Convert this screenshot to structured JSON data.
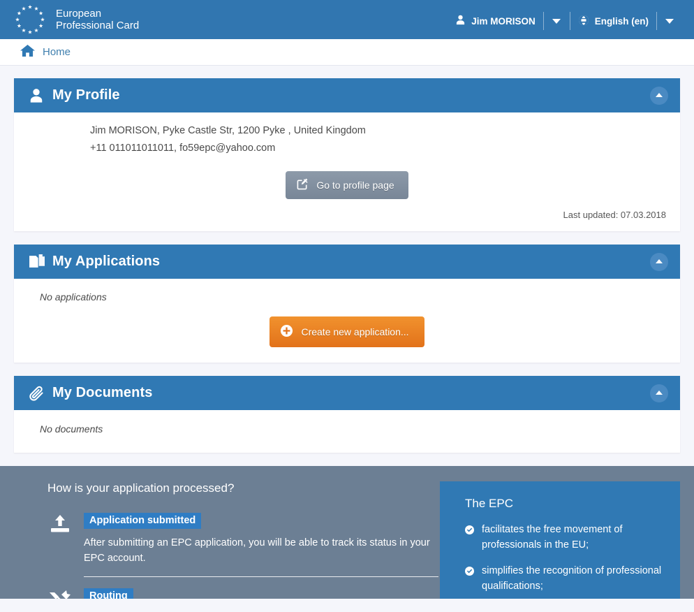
{
  "header": {
    "brand_line1": "European",
    "brand_line2": "Professional Card",
    "logo_icon": "eu-flag-stars-icon",
    "user_icon": "user-icon",
    "user_name": "Jim MORISON",
    "user_caret_icon": "caret-down-icon",
    "language_icon": "globe-icon",
    "language": "English (en)",
    "language_caret_icon": "caret-down-icon"
  },
  "breadcrumb": {
    "home_icon": "home-icon",
    "home_label": "Home"
  },
  "profile_card": {
    "icon": "user-icon",
    "title": "My Profile",
    "collapse_icon": "chevron-up-icon",
    "line1": "Jim MORISON, Pyke Castle Str, 1200 Pyke , United Kingdom",
    "line2": "+11 011011011011, fo59epc@yahoo.com",
    "button_icon": "edit-square-icon",
    "button_label": "Go to profile page",
    "last_updated": "Last updated: 07.03.2018"
  },
  "applications_card": {
    "icon": "documents-icon",
    "title": "My Applications",
    "collapse_icon": "chevron-up-icon",
    "empty_text": "No applications",
    "button_icon": "plus-circle-icon",
    "button_label": "Create new application..."
  },
  "documents_card": {
    "icon": "paperclip-icon",
    "title": "My Documents",
    "collapse_icon": "chevron-up-icon",
    "empty_text": "No documents"
  },
  "info": {
    "title": "How is your application processed?",
    "steps": [
      {
        "icon": "upload-icon",
        "badge": "Application submitted",
        "text": "After submitting an EPC application, you will be able to track its status in your EPC account."
      },
      {
        "icon": "routing-arrows-icon",
        "badge": "Routing",
        "text": ""
      }
    ],
    "epc_title": "The EPC",
    "epc_bullet_icon": "check-circle-icon",
    "epc_items": [
      "facilitates the free movement of professionals in the EU;",
      "simplifies the recognition of professional qualifications;"
    ]
  },
  "colors": {
    "brand_blue": "#3176b0",
    "card_header_blue": "#3079b4",
    "accent_orange": "#e2721a",
    "info_slate": "#6c7f94",
    "page_background": "#f5f6fb"
  }
}
